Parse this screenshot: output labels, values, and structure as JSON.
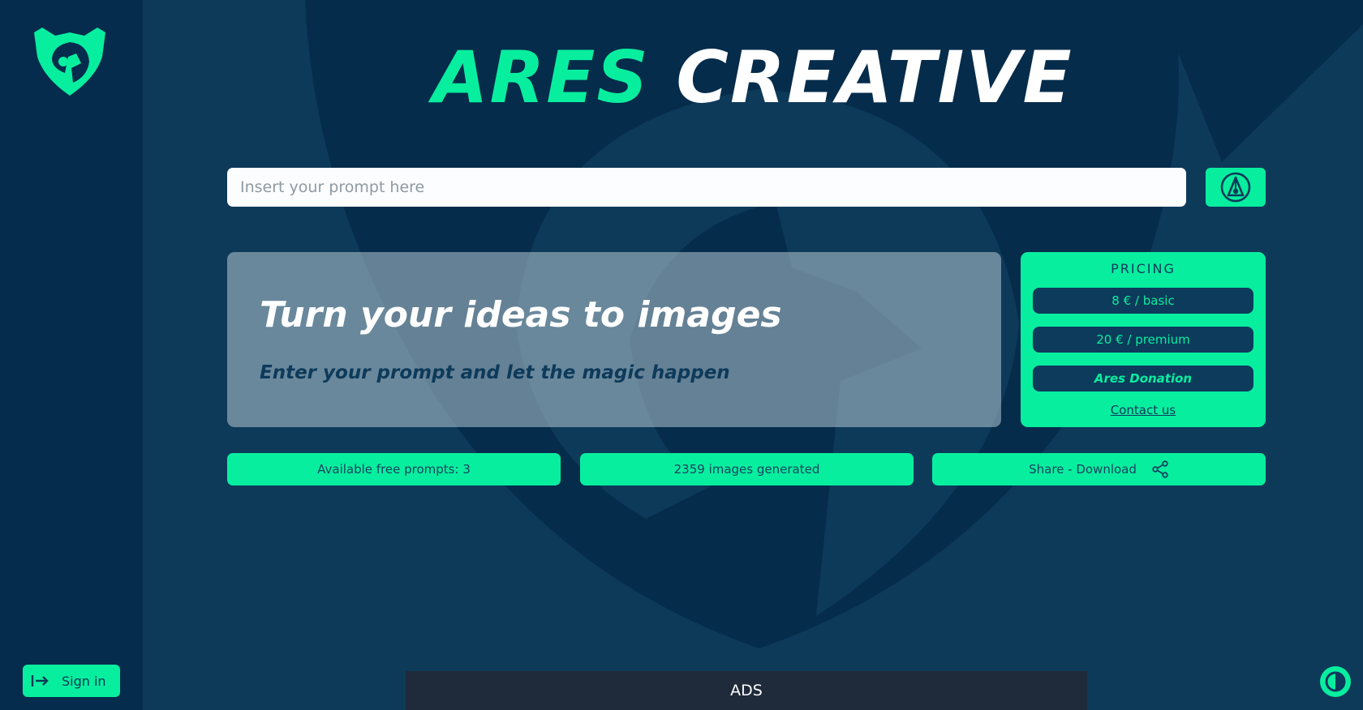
{
  "header": {
    "title_part1": "ARES",
    "title_part2": "CREATIVE"
  },
  "prompt": {
    "placeholder": "Insert your prompt here",
    "value": ""
  },
  "hero": {
    "title": "Turn your ideas to images",
    "subtitle": "Enter your prompt and let the magic happen"
  },
  "pricing": {
    "heading": "PRICING",
    "basic": "8 € / basic",
    "premium": "20 € / premium",
    "donation": "Ares Donation",
    "contact": "Contact us"
  },
  "stats": {
    "free_prompts": "Available free prompts: 3",
    "images_generated": "2359 images generated",
    "share_download": "Share - Download"
  },
  "ads": {
    "label": "ADS"
  },
  "sidebar": {
    "sign_in": "Sign in"
  },
  "icons": {
    "logo": "ares-shield-logo-icon",
    "generate": "pen-nib-icon",
    "share": "share-icon",
    "sign_in": "sign-in-arrow-icon",
    "theme": "theme-toggle-icon"
  },
  "colors": {
    "accent": "#08ee9f",
    "sidebar_bg": "#062c4d",
    "main_bg": "#0e3a5a",
    "ads_bg": "#1f2a3a"
  }
}
